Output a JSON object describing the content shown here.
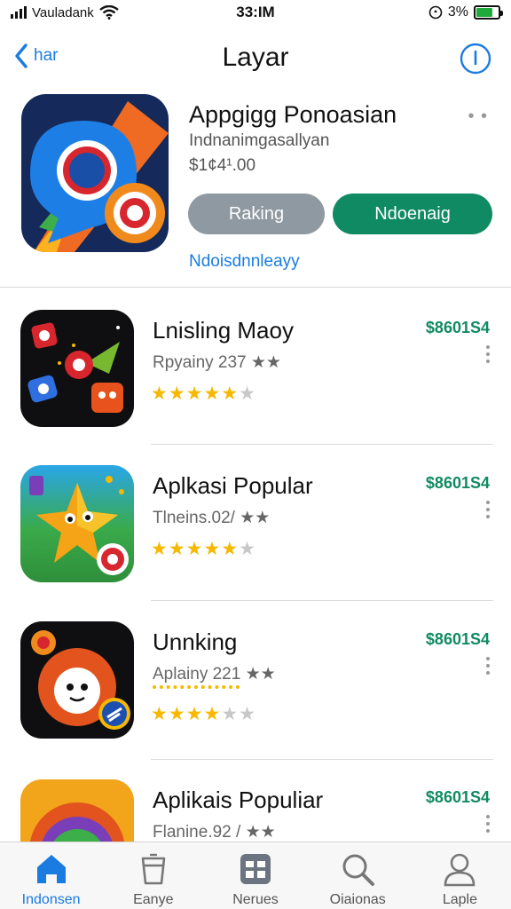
{
  "status_bar": {
    "carrier": "Vauladank",
    "time": "33:IM",
    "battery": "3%"
  },
  "nav": {
    "back_label": "har",
    "title": "Layar"
  },
  "featured": {
    "title": "Appgigg Ponoasian",
    "subtitle": "Indnanimgasallyan",
    "price": "$1¢4¹.00",
    "more": "• •",
    "rank_button": "Raking",
    "get_button": "Ndoenaig",
    "link": "Ndoisdnnleayy"
  },
  "apps": [
    {
      "name": "Lnisling Maoy",
      "meta": "Rpyainy 237 ★★",
      "price": "$8601S4",
      "rating": 4.5
    },
    {
      "name": "Aplkasi Popular",
      "meta": "Tlneins.02/ ★★",
      "price": "$8601S4",
      "rating": 4.5
    },
    {
      "name": "Unnking",
      "meta": "Aplainy 221 ★★",
      "price": "$8601S4",
      "rating": 3.5
    },
    {
      "name": "Aplikais Populiar",
      "meta": "Flanine.92 / ★★",
      "price": "$8601S4",
      "rating": 0
    }
  ],
  "tabs": [
    {
      "label": "Indonsen",
      "icon": "home-icon",
      "active": true
    },
    {
      "label": "Eanye",
      "icon": "cup-icon",
      "active": false
    },
    {
      "label": "Nerues",
      "icon": "grid-icon",
      "active": false
    },
    {
      "label": "Oiaionas",
      "icon": "search-icon",
      "active": false
    },
    {
      "label": "Laple",
      "icon": "person-icon",
      "active": false
    }
  ],
  "colors": {
    "accent": "#1a7ce0",
    "green": "#108a62",
    "star": "#f6b800"
  }
}
